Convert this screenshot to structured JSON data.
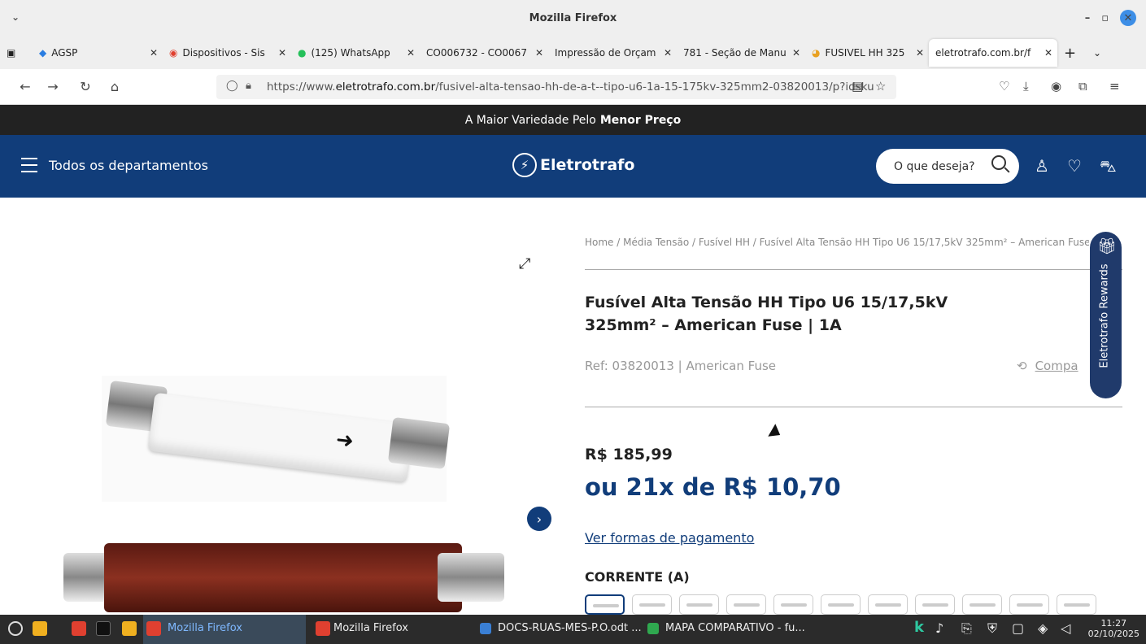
{
  "window": {
    "title": "Mozilla Firefox"
  },
  "tabs": [
    {
      "label": "AGSP"
    },
    {
      "label": "Dispositivos - Sis"
    },
    {
      "label": "(125) WhatsApp"
    },
    {
      "label": "CO006732 - CO0067"
    },
    {
      "label": "Impressão de Orçam"
    },
    {
      "label": "781 - Seção de Manu"
    },
    {
      "label": "FUSIVEL HH 325"
    },
    {
      "label": "eletrotrafo.com.br/f"
    }
  ],
  "url": {
    "prefix": "https://www.",
    "host": "eletrotrafo.com.br",
    "path": "/fusivel-alta-tensao-hh-de-a-t--tipo-u6-1a-15-175kv-325mm2-03820013/p?idsku"
  },
  "site": {
    "promo_text": "A Maior Variedade Pelo",
    "promo_bold": "Menor Preço",
    "departments_label": "Todos os departamentos",
    "logo_text": "Eletrotrafo",
    "search_placeholder": "O que deseja?"
  },
  "product": {
    "breadcrumb": "Home / Média Tensão / Fusível HH / Fusível Alta Tensão HH Tipo U6 15/17,5kV 325mm² – American Fuse | 1A",
    "title": "Fusível Alta Tensão HH Tipo U6 15/17,5kV 325mm² – American Fuse | 1A",
    "ref": "Ref: 03820013 | American Fuse",
    "compare_label": "Compa",
    "price": "R$ 185,99",
    "installments": "ou 21x de R$ 10,70",
    "payment_link": "Ver formas de pagamento",
    "option_label": "CORRENTE (A)"
  },
  "rewards": {
    "label": "Eletrotrafo Rewards"
  },
  "taskbar": {
    "items": [
      "Mozilla Firefox",
      "Mozilla Firefox",
      "DOCS-RUAS-MES-P.O.odt ...",
      "MAPA COMPARATIVO - fu..."
    ],
    "time": "11:27",
    "date": "02/10/2025"
  }
}
